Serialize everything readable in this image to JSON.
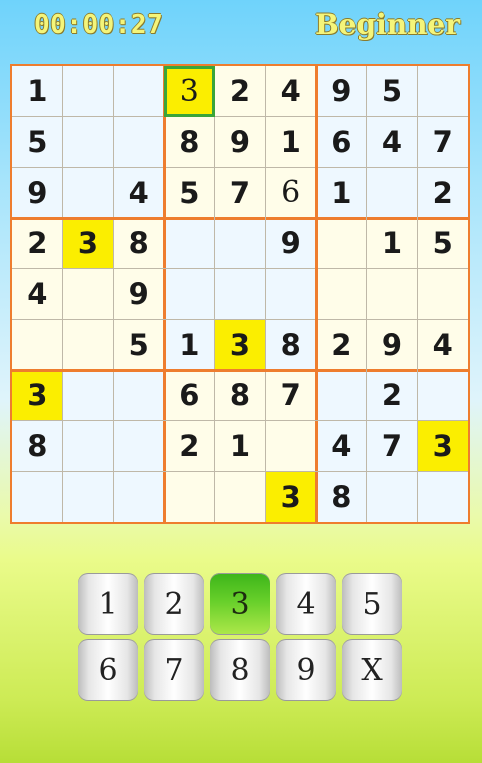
{
  "header": {
    "timer": "00:00:27",
    "difficulty": "Beginner"
  },
  "board": {
    "highlight_digit": "3",
    "selected": [
      0,
      3
    ],
    "rows": [
      [
        "1",
        "",
        "",
        "3",
        "2",
        "4",
        "9",
        "5",
        ""
      ],
      [
        "5",
        "",
        "",
        "8",
        "9",
        "1",
        "6",
        "4",
        "7"
      ],
      [
        "9",
        "",
        "4",
        "5",
        "7",
        "6",
        "1",
        "",
        "2"
      ],
      [
        "2",
        "3",
        "8",
        "",
        "",
        "9",
        "",
        "1",
        "5"
      ],
      [
        "4",
        "",
        "9",
        "",
        "",
        "",
        "",
        "",
        ""
      ],
      [
        "",
        "",
        "5",
        "1",
        "3",
        "8",
        "2",
        "9",
        "4"
      ],
      [
        "3",
        "",
        "",
        "6",
        "8",
        "7",
        "",
        "2",
        ""
      ],
      [
        "8",
        "",
        "",
        "2",
        "1",
        "",
        "4",
        "7",
        "3"
      ],
      [
        "",
        "",
        "",
        "",
        "",
        "3",
        "8",
        "",
        ""
      ]
    ],
    "user_entries": [
      [
        0,
        3
      ],
      [
        2,
        5
      ]
    ],
    "colors": {
      "border": "#ee7d2e",
      "highlight": "#fbee00",
      "selection": "#3aa53a"
    }
  },
  "keypad": {
    "keys": [
      "1",
      "2",
      "3",
      "4",
      "5",
      "6",
      "7",
      "8",
      "9",
      "X"
    ],
    "active": "3"
  }
}
